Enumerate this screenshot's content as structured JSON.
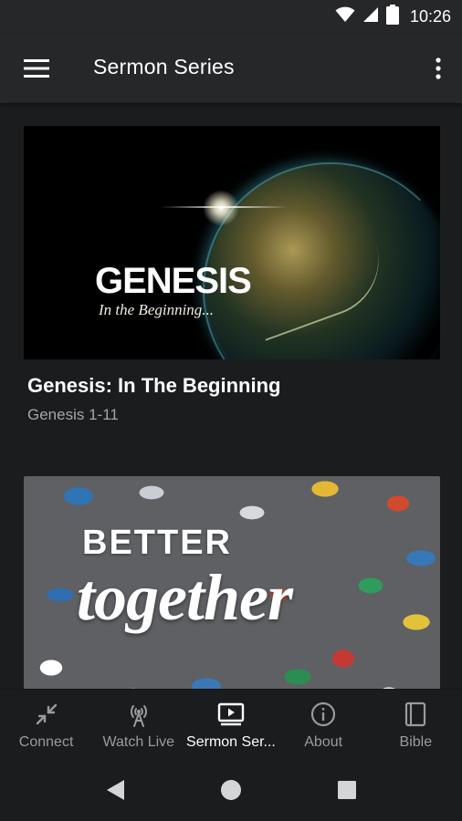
{
  "status_bar": {
    "time": "10:26",
    "icons": [
      "wifi-icon",
      "cell-signal-icon",
      "battery-icon"
    ]
  },
  "app_bar": {
    "title": "Sermon Series",
    "menu_icon": "hamburger-menu-icon",
    "overflow_icon": "more-vert-icon"
  },
  "series": [
    {
      "title": "Genesis: In The Beginning",
      "subtitle": "Genesis 1-11",
      "artwork": {
        "headline": "GENESIS",
        "tagline": "In the Beginning..."
      }
    },
    {
      "title": "",
      "subtitle": "",
      "artwork": {
        "headline": "BETTER",
        "tagline": "together"
      }
    }
  ],
  "bottom_nav": {
    "items": [
      {
        "label": "Connect",
        "icon": "connect-arrows-icon",
        "active": false
      },
      {
        "label": "Watch Live",
        "icon": "broadcast-icon",
        "active": false
      },
      {
        "label": "Sermon Ser...",
        "icon": "video-play-icon",
        "active": true
      },
      {
        "label": "About",
        "icon": "info-icon",
        "active": false
      },
      {
        "label": "Bible",
        "icon": "book-icon",
        "active": false
      }
    ]
  },
  "system_nav": {
    "icons": [
      "back-icon",
      "home-icon",
      "recents-icon"
    ]
  },
  "colors": {
    "background": "#1b1c1e",
    "app_bar": "#262729",
    "text_primary": "#ffffff",
    "text_secondary": "#a4a5a8",
    "nav_inactive": "#9a9b9e"
  }
}
